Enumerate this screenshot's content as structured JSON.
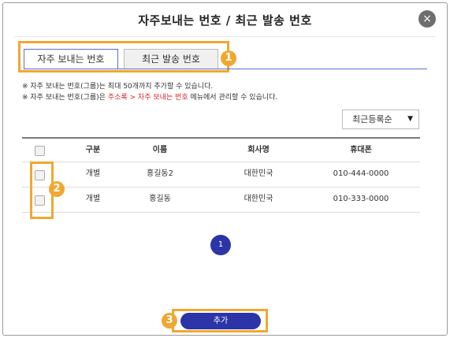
{
  "dialog": {
    "title": "자주보내는 번호 / 최근 발송 번호",
    "close_icon": "×"
  },
  "tabs": [
    {
      "label": "자주 보내는 번호",
      "active": true
    },
    {
      "label": "최근 발송 번호",
      "active": false
    }
  ],
  "callouts": [
    "1",
    "2",
    "3"
  ],
  "notices": {
    "line1": "※ 자주 보내는 번호(그룹)는 최대 50개까지 추가할 수 있습니다.",
    "line2_prefix": "※ 자주 보내는 번호(그룹)은 ",
    "line2_highlight": "주소록 > 자주 보내는 번호",
    "line2_suffix": " 메뉴에서 관리할 수 있습니다."
  },
  "sort_select": {
    "value": "최근등록순",
    "arrow": "▼"
  },
  "table": {
    "headers": [
      "구분",
      "이름",
      "회사명",
      "휴대폰"
    ],
    "rows": [
      {
        "type": "개별",
        "name": "홍길동2",
        "company": "대한민국",
        "phone": "010-444-0000"
      },
      {
        "type": "개별",
        "name": "홍길동",
        "company": "대한민국",
        "phone": "010-333-0000"
      }
    ]
  },
  "pagination": {
    "current": "1"
  },
  "add_button": {
    "label": "추가"
  },
  "colors": {
    "accent": "#2b35a8",
    "callout": "#f0a830",
    "highlight_text": "#e0242a"
  }
}
